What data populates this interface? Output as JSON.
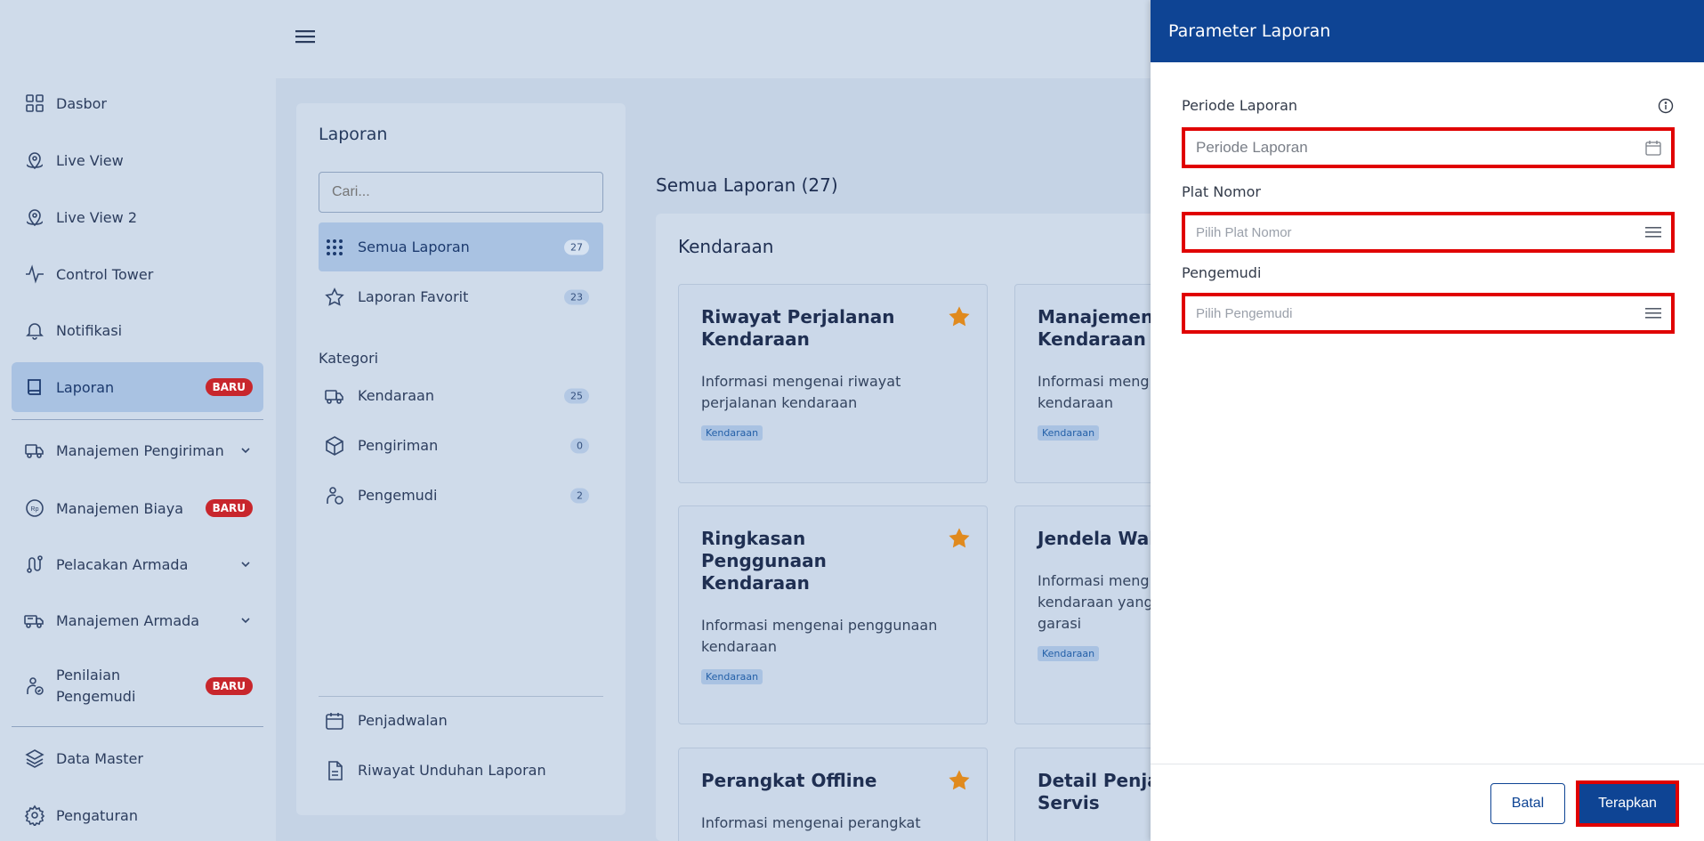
{
  "sidebar": {
    "items": [
      {
        "label": "Dasbor",
        "icon": "grid-icon"
      },
      {
        "label": "Live View",
        "icon": "location-icon"
      },
      {
        "label": "Live View 2",
        "icon": "location-icon"
      },
      {
        "label": "Control Tower",
        "icon": "activity-icon"
      },
      {
        "label": "Notifikasi",
        "icon": "bell-icon"
      },
      {
        "label": "Laporan",
        "icon": "book-icon",
        "badge": "BARU",
        "active": true
      },
      {
        "label": "Manajemen Pengiriman",
        "icon": "truck-icon"
      },
      {
        "label": "Manajemen Biaya",
        "icon": "rupiah-icon",
        "badge": "BARU"
      },
      {
        "label": "Pelacakan Armada",
        "icon": "route-icon"
      },
      {
        "label": "Manajemen Armada",
        "icon": "fleet-icon"
      },
      {
        "label": "Penilaian Pengemudi",
        "icon": "driver-icon",
        "badge": "BARU"
      },
      {
        "label": "Data Master",
        "icon": "layers-icon"
      },
      {
        "label": "Pengaturan",
        "icon": "gear-icon"
      }
    ]
  },
  "laporan_panel": {
    "title": "Laporan",
    "search_placeholder": "Cari...",
    "items": [
      {
        "label": "Semua Laporan",
        "count": "27"
      },
      {
        "label": "Laporan Favorit",
        "count": "23"
      }
    ],
    "kategori_label": "Kategori",
    "categories": [
      {
        "label": "Kendaraan",
        "count": "25"
      },
      {
        "label": "Pengiriman",
        "count": "0"
      },
      {
        "label": "Pengemudi",
        "count": "2"
      }
    ],
    "footer_items": [
      {
        "label": "Penjadwalan"
      },
      {
        "label": "Riwayat Unduhan Laporan"
      }
    ]
  },
  "reports": {
    "title": "Semua Laporan (27)",
    "category_title": "Kendaraan",
    "cards": [
      {
        "title": "Riwayat Perjalanan Kendaraan",
        "desc": "Informasi mengenai riwayat perjalanan kendaraan",
        "tag": "Kendaraan"
      },
      {
        "title": "Manajemen Kendaraan",
        "desc": "Informasi meng kendaraan",
        "tag": "Kendaraan"
      },
      {
        "title": "Ringkasan Penggunaan Kendaraan",
        "desc": "Informasi mengenai penggunaan kendaraan",
        "tag": "Kendaraan"
      },
      {
        "title": "Jendela Wak",
        "desc": "Informasi meng kendaraan yang garasi",
        "tag": "Kendaraan"
      },
      {
        "title": "Perangkat Offline",
        "desc": "Informasi mengenai perangkat"
      },
      {
        "title": "Detail Penja Servis"
      }
    ]
  },
  "drawer": {
    "title": "Parameter Laporan",
    "periode_label": "Periode Laporan",
    "periode_placeholder": "Periode Laporan",
    "plat_label": "Plat Nomor",
    "plat_placeholder": "Pilih Plat Nomor",
    "pengemudi_label": "Pengemudi",
    "pengemudi_placeholder": "Pilih Pengemudi",
    "batal": "Batal",
    "terapkan": "Terapkan"
  },
  "colors": {
    "accent": "#0e4494",
    "badge": "#c8262c",
    "highlight": "#e00000",
    "star": "#e08a1e"
  }
}
